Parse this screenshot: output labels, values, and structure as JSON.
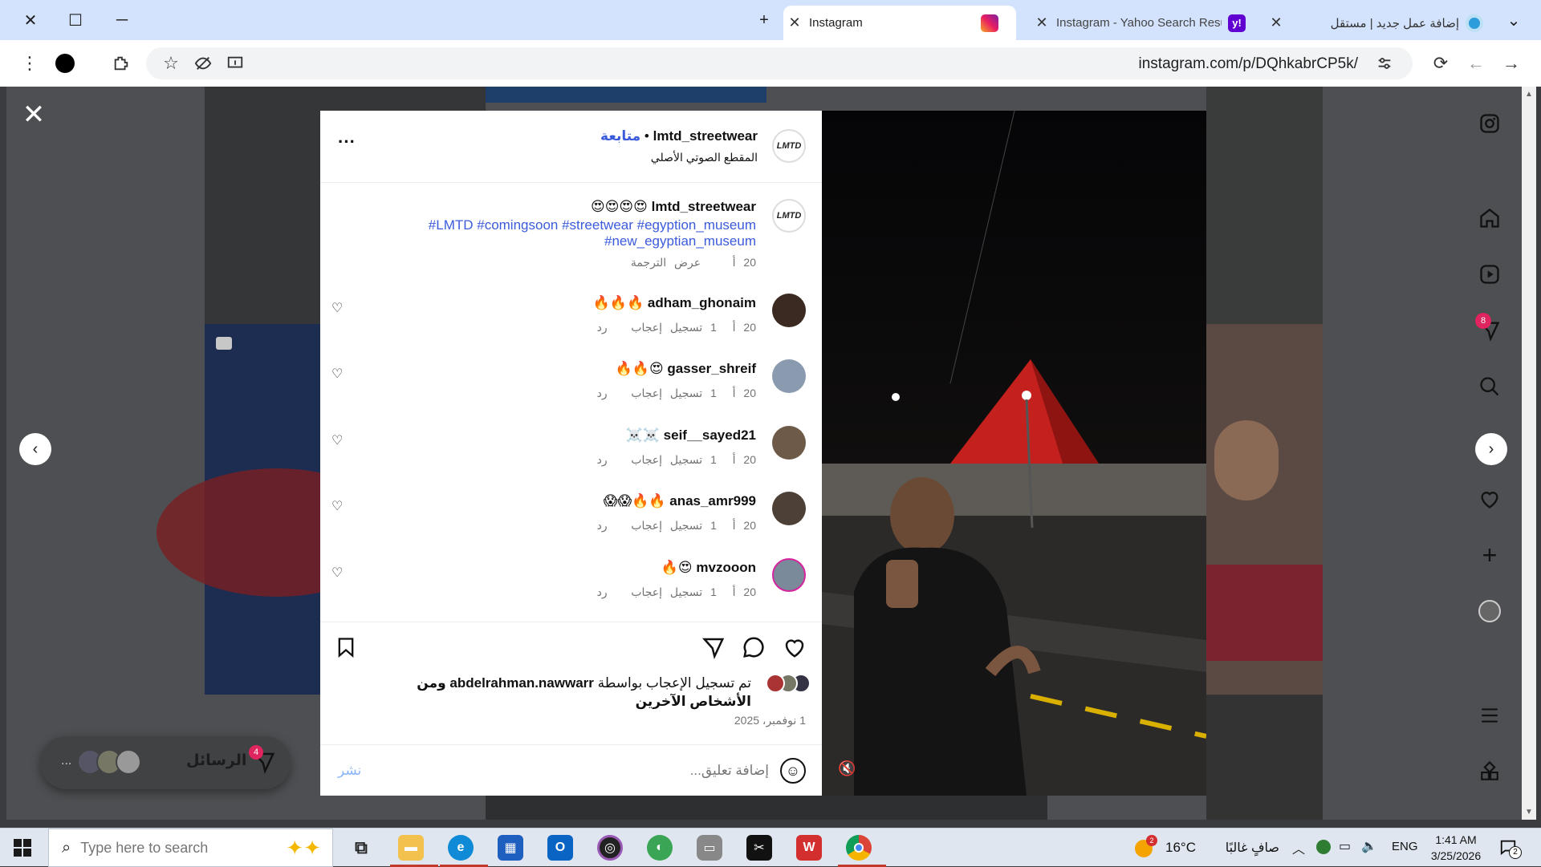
{
  "tabs": [
    {
      "title": "Instagram",
      "active": true,
      "icon": "instagram-icon"
    },
    {
      "title": "Instagram - Yahoo Search Resu",
      "active": false,
      "icon": "yahoo-icon"
    },
    {
      "title": "إضافة عمل جديد | مستقل",
      "active": false,
      "icon": "mostaql-icon"
    }
  ],
  "address": {
    "url": "instagram.com/p/DQhkabrCP5k/"
  },
  "post": {
    "author": "lmtd_streetwear",
    "separator": "•",
    "follow_label": "متابعة",
    "audio": "المقطع الصوتي الأصلي",
    "avatar_text": "LMTD",
    "caption": {
      "author": "lmtd_streetwear",
      "emojis": "😍😍😍😍",
      "hashtags_line1": "#LMTD #comingsoon #streetwear #egyption_museum",
      "hashtags_line2": "#new_egyptian_museum",
      "time": "20 أ",
      "translate": "عرض الترجمة"
    },
    "comments": [
      {
        "user": "adham_ghonaim",
        "text": "🔥🔥🔥",
        "time": "20 أ",
        "likes": "1 تسجيل إعجاب",
        "reply": "رد"
      },
      {
        "user": "gasser_shreif",
        "text": "😍🔥🔥",
        "time": "20 أ",
        "likes": "1 تسجيل إعجاب",
        "reply": "رد"
      },
      {
        "user": "seif__sayed21",
        "text": "☠️☠️",
        "time": "20 أ",
        "likes": "1 تسجيل إعجاب",
        "reply": "رد"
      },
      {
        "user": "anas_amr999",
        "text": "🔥🔥😱😱",
        "time": "20 أ",
        "likes": "1 تسجيل إعجاب",
        "reply": "رد"
      },
      {
        "user": "mvzooon",
        "text": "😍🔥",
        "time": "20 أ",
        "likes": "1 تسجيل إعجاب",
        "reply": "رد"
      }
    ],
    "likes_prefix": "تم تسجيل الإعجاب بواسطة",
    "likes_user": "abdelrahman.nawwarr",
    "likes_suffix": "ومن الأشخاص الآخرين",
    "date": "1 نوفمبر، 2025",
    "comment_placeholder": "إضافة تعليق...",
    "post_label": "نشر"
  },
  "sidebar": {
    "notification_badge": "8"
  },
  "messages": {
    "label": "الرسائل",
    "badge": "4",
    "more": "..."
  },
  "taskbar": {
    "search_placeholder": "Type here to search",
    "weather_temp": "16°C",
    "weather_text": "صافٍ غالبًا",
    "weather_badge": "2",
    "lang": "ENG",
    "time": "1:41 AM",
    "date": "3/25/2026",
    "notif_count": "2"
  },
  "colors": {
    "tabbar": "#d3e3fd",
    "link": "#3b5bdb",
    "pyramid": "#c4201e"
  }
}
